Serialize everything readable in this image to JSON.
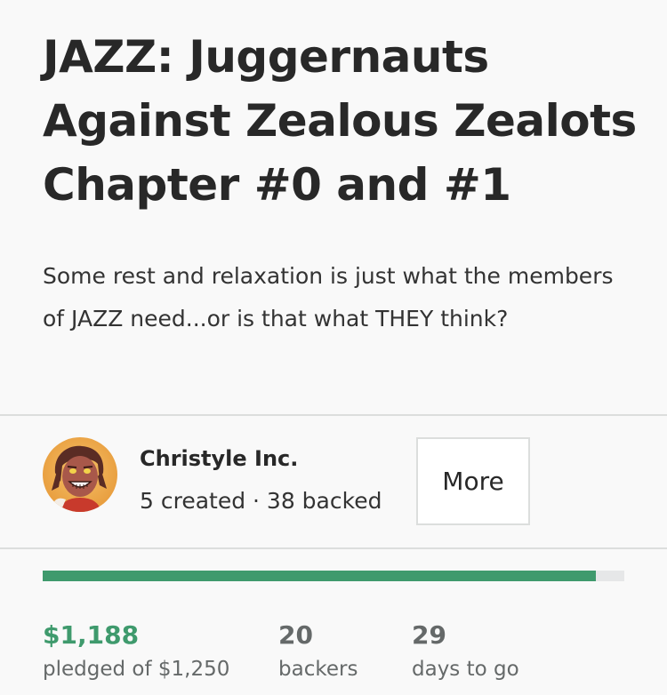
{
  "project": {
    "title": "JAZZ: Juggernauts Against Zealous Zealots Chapter #0 and #1",
    "blurb": "Some rest and relaxation is just what the members of JAZZ need...or is that what THEY think?"
  },
  "creator": {
    "name": "Christyle Inc.",
    "stats": "5 created · 38 backed",
    "more_label": "More",
    "avatar_icon": "cartoon-avatar-icon"
  },
  "funding": {
    "progress_fraction": 0.9504,
    "pledged_value": "$1,188",
    "pledged_label": "pledged of $1,250",
    "backers_value": "20",
    "backers_label": "backers",
    "days_value": "29",
    "days_label": "days to go"
  },
  "colors": {
    "accent_green": "#3f9a6d",
    "track_gray": "#e6e7e8"
  }
}
